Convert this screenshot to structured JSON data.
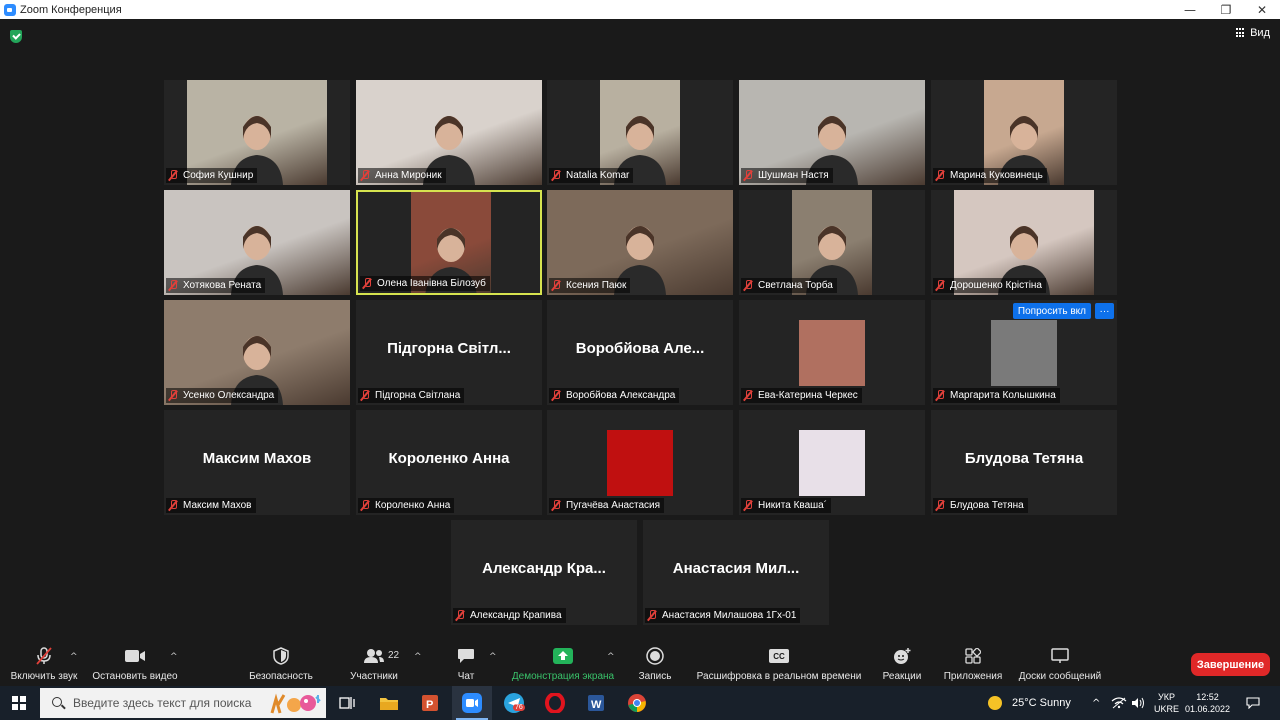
{
  "window": {
    "title": "Zoom Конференция",
    "minimize": "—",
    "maximize": "❐",
    "close": "✕"
  },
  "view_label": "Вид",
  "participants": [
    {
      "name": "София Кушнир",
      "video": true,
      "bg": "#b9b3a4"
    },
    {
      "name": "Анна Мироник",
      "video": true,
      "bg": "#d9d2cc"
    },
    {
      "name": "Natalia Komar",
      "video": true,
      "bg": "#b8b0a0"
    },
    {
      "name": "Шушман Настя",
      "video": true,
      "bg": "#b8b6b1"
    },
    {
      "name": "Марина Куковинець",
      "video": true,
      "bg": "#c7a890"
    },
    {
      "name": "Хотякова Рената",
      "video": true,
      "bg": "#c9c4c0"
    },
    {
      "name": "Олена Іванівна Білозуб",
      "video": true,
      "bg": "#8a4a3a",
      "active": true
    },
    {
      "name": "Ксения Паюк",
      "video": true,
      "bg": "#7d6a5a"
    },
    {
      "name": "Светлана Торба",
      "video": true,
      "bg": "#8b7f70"
    },
    {
      "name": "Дорошенко Крістіна",
      "video": true,
      "bg": "#d5c7c0"
    },
    {
      "name": "Усенко Олександра",
      "video": true,
      "bg": "#8e7c6c"
    },
    {
      "name": "Підгорна Світлана",
      "display": "Підгорна Світл...",
      "video": false
    },
    {
      "name": "Воробйова Александра",
      "display": "Воробйова Але...",
      "video": false
    },
    {
      "name": "Ева-Катерина Черкес",
      "video": false,
      "avatar": "#b07060"
    },
    {
      "name": "Маргарита Колышкина",
      "video": false,
      "avatar": "#7a7a7a",
      "ask_button": "Попросить вкл",
      "more_button": "···"
    },
    {
      "name": "Максим Махов",
      "display": "Максим Махов",
      "video": false
    },
    {
      "name": "Короленко Анна",
      "display": "Короленко Анна",
      "video": false
    },
    {
      "name": "Пугачёва Анастасия",
      "video": false,
      "avatar": "#c01010"
    },
    {
      "name": "Никита Кваша´",
      "video": false,
      "avatar": "#e8e0e8"
    },
    {
      "name": "Блудова Тетяна",
      "display": "Блудова Тетяна",
      "video": false
    },
    {
      "name": "Александр Крапива",
      "display": "Александр Кра...",
      "video": false
    },
    {
      "name": "Анастасия Милашова 1Гх-01",
      "display": "Анастасия Мил...",
      "video": false
    }
  ],
  "toolbar": {
    "unmute": "Включить звук",
    "stop_video": "Остановить видео",
    "security": "Безопасность",
    "participants": "Участники",
    "participants_count": "22",
    "chat": "Чат",
    "share_screen": "Демонстрация экрана",
    "record": "Запись",
    "captions": "Расшифровка в реальном времени",
    "captions_icon_text": "CC",
    "reactions": "Реакции",
    "apps": "Приложения",
    "whiteboards": "Доски сообщений",
    "end": "Завершение",
    "caret": "^"
  },
  "taskbar": {
    "search_placeholder": "Введите здесь текст для поиска",
    "weather": "25°C  Sunny",
    "lang": "УКР",
    "lang_sub": "UKRE",
    "time": "12:52",
    "date": "01.06.2022",
    "telegram_badge": "76",
    "chevron": "^"
  }
}
